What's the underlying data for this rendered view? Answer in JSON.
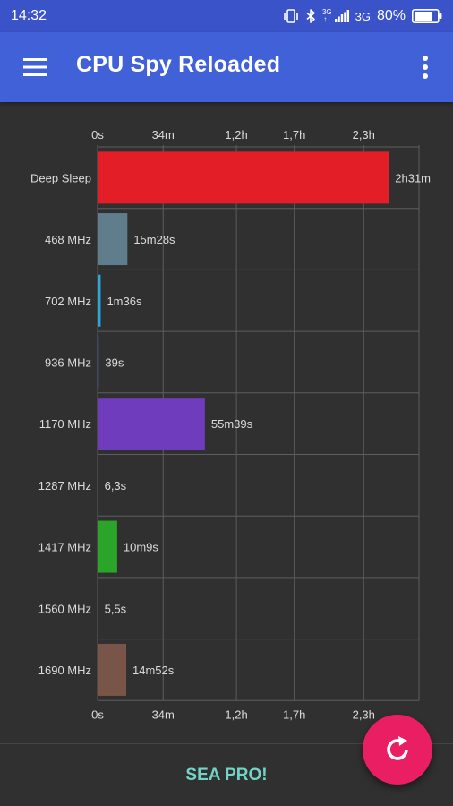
{
  "status_bar": {
    "time": "14:32",
    "network_small_top": "3G",
    "network_small_bottom": "↑↓",
    "network_type": "3G",
    "battery_percent": "80%",
    "battery_level": 0.8,
    "icons": [
      "vibrate-icon",
      "bluetooth-icon",
      "signal-icon",
      "battery-icon"
    ]
  },
  "app_bar": {
    "title": "CPU Spy Reloaded",
    "menu_icon": "hamburger-menu-icon",
    "overflow_icon": "more-vert-icon",
    "color": "#4161d9"
  },
  "chart_data": {
    "type": "bar",
    "orientation": "horizontal",
    "categories": [
      "Deep Sleep",
      "468 MHz",
      "702 MHz",
      "936 MHz",
      "1170 MHz",
      "1287 MHz",
      "1417 MHz",
      "1560 MHz",
      "1690 MHz"
    ],
    "values_seconds": [
      9060,
      928,
      96,
      39,
      3339,
      6.3,
      609,
      5.5,
      892
    ],
    "value_labels": [
      "2h31m",
      "15m28s",
      "1m36s",
      "39s",
      "55m39s",
      "6,3s",
      "10m9s",
      "5,5s",
      "14m52s"
    ],
    "colors": [
      "#e31e26",
      "#607d8b",
      "#26a9e0",
      "#3f51b5",
      "#6e3cbc",
      "#2aa84a",
      "#2aa52a",
      "#999999",
      "#795548"
    ],
    "x_ticks_seconds": [
      0,
      2040,
      4320,
      6120,
      8280
    ],
    "x_tick_labels": [
      "0s",
      "34m",
      "1,2h",
      "1,7h",
      "2,3h"
    ],
    "xlim_seconds": [
      0,
      10000
    ],
    "grid": true,
    "legend": "none"
  },
  "footer": {
    "promo_label": "SEA PRO!",
    "promo_color": "#72d3c6"
  },
  "fab": {
    "icon": "refresh-icon",
    "color": "#e91e63"
  }
}
